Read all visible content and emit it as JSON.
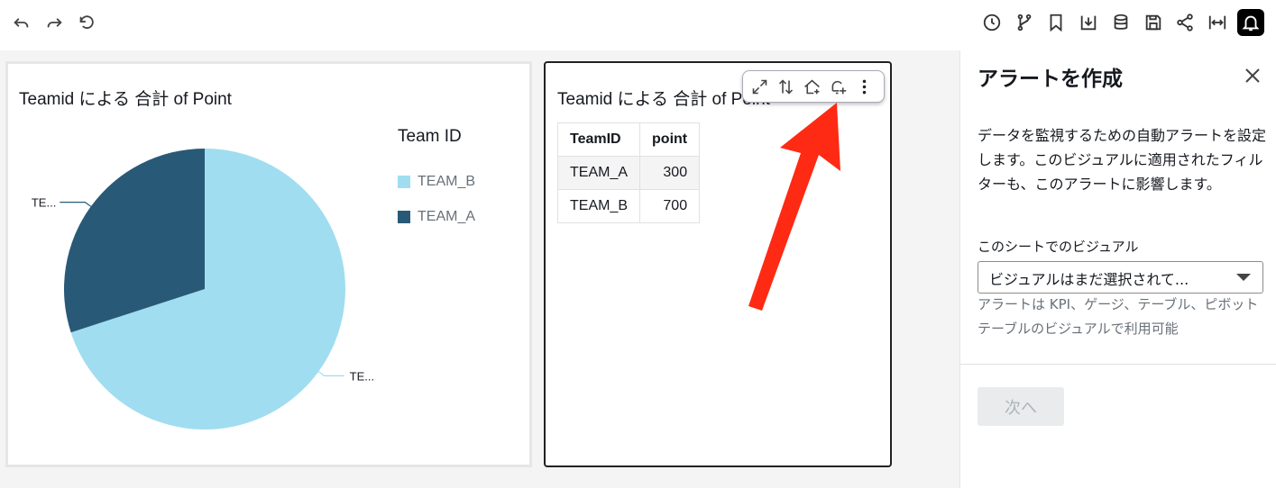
{
  "toolbar": {
    "left_icons": [
      "undo-icon",
      "redo-icon",
      "reset-icon"
    ],
    "right_icons": [
      "history-icon",
      "branch-icon",
      "bookmark-icon",
      "download-icon",
      "database-icon",
      "save-icon",
      "share-icon",
      "fit-width-icon",
      "bell-icon"
    ]
  },
  "pie_visual": {
    "title": "Teamid による 合計 of Point",
    "legend_title": "Team ID",
    "slice_label_a": "TE...",
    "slice_label_b": "TE...",
    "chart_data": {
      "type": "pie",
      "categories": [
        "TEAM_B",
        "TEAM_A"
      ],
      "values": [
        700,
        300
      ],
      "colors": [
        "#a0ddf0",
        "#285a77"
      ],
      "legend": [
        "TEAM_B",
        "TEAM_A"
      ]
    }
  },
  "table_visual": {
    "title": "Teamid による 合計 of Point",
    "columns": [
      "TeamID",
      "point"
    ],
    "rows": [
      [
        "TEAM_A",
        "300"
      ],
      [
        "TEAM_B",
        "700"
      ]
    ],
    "toolbar_icons": [
      "expand-icon",
      "sort-icon",
      "home-up-icon",
      "alert-add-icon",
      "more-icon"
    ]
  },
  "alert_panel": {
    "title": "アラートを作成",
    "description": "データを監視するための自動アラートを設定します。このビジュアルに適用されたフィルターも、このアラートに影響します。",
    "visual_label": "このシートでのビジュアル",
    "select_value": "ビジュアルはまだ選択されて...",
    "hint": "アラートは KPI、ゲージ、テーブル、ピボットテーブルのビジュアルで利用可能",
    "next_button": "次へ"
  },
  "colors": {
    "annotation_arrow": "#ff2a14",
    "pie_team_b": "#a0ddf0",
    "pie_team_a": "#285a77"
  }
}
